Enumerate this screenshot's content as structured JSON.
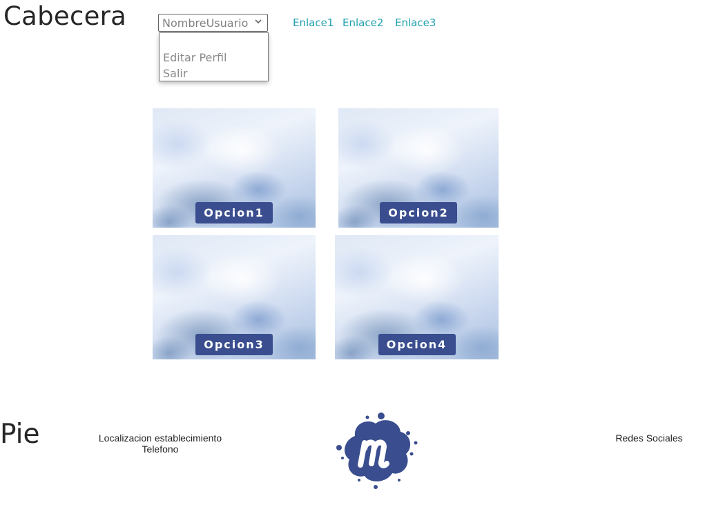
{
  "header": {
    "title": "Cabecera",
    "user_select": {
      "value": "NombreUsuario"
    },
    "dropdown": {
      "items": [
        "Editar Perfil",
        "Salir"
      ]
    },
    "links": [
      "Enlace1",
      "Enlace2",
      "Enlace3"
    ]
  },
  "options": [
    "Opcion1",
    "Opcion2",
    "Opcion3",
    "Opcion4"
  ],
  "footer": {
    "title": "Pie",
    "location": "Localizacion establecimiento",
    "phone": "Telefono",
    "social": "Redes Sociales"
  },
  "colors": {
    "link": "#1f9fb0",
    "button": "#3a4e8f",
    "logo": "#3a4e8f"
  },
  "icons": {
    "select_chevron": "chevron-down-icon",
    "logo": "meetup-logo-icon"
  }
}
